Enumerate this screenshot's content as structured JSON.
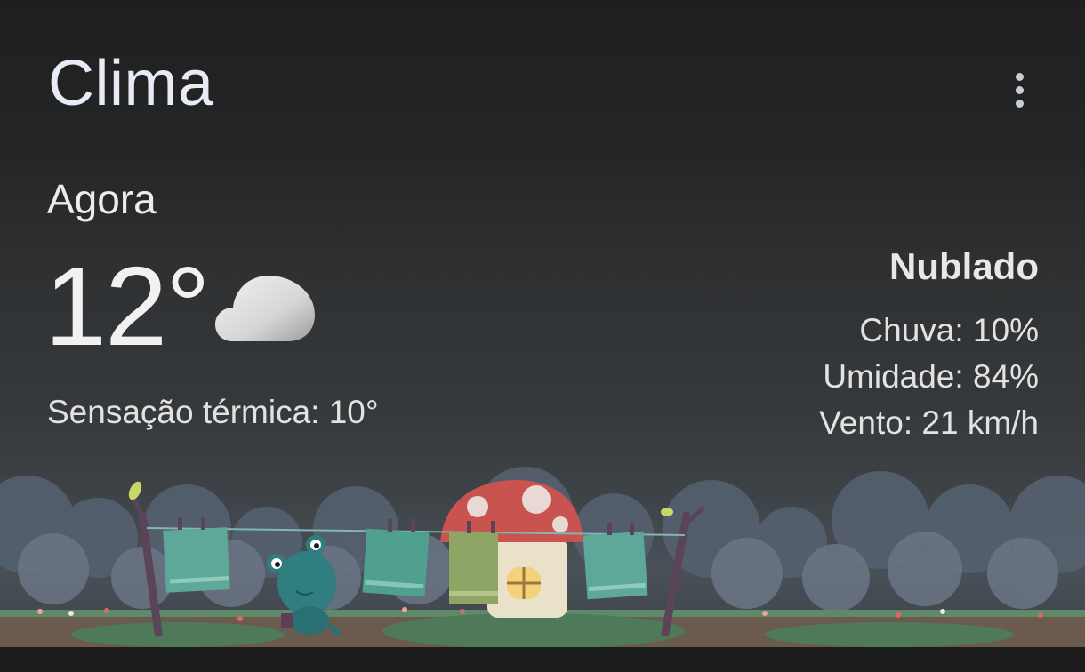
{
  "header": {
    "title": "Clima",
    "menu_icon": "more-vert-icon"
  },
  "current": {
    "section_label": "Agora",
    "temperature": "12°",
    "condition_icon": "cloud-icon",
    "feels_like": "Sensação térmica: 10°",
    "condition": "Nublado",
    "precipitation": "Chuva: 10%",
    "humidity": "Umidade: 84%",
    "wind": "Vento: 21 km/h"
  },
  "illustration": {
    "name": "frog-laundry-mushroom-house-scene",
    "colors": {
      "sky": "#3e4347",
      "clouds": "#5d6676",
      "ground": "#6b5a4e",
      "grass": "#4f7a5a",
      "mushroom_cap": "#c9534f",
      "frog": "#2f7e80",
      "towels": "#5ea89a"
    }
  }
}
